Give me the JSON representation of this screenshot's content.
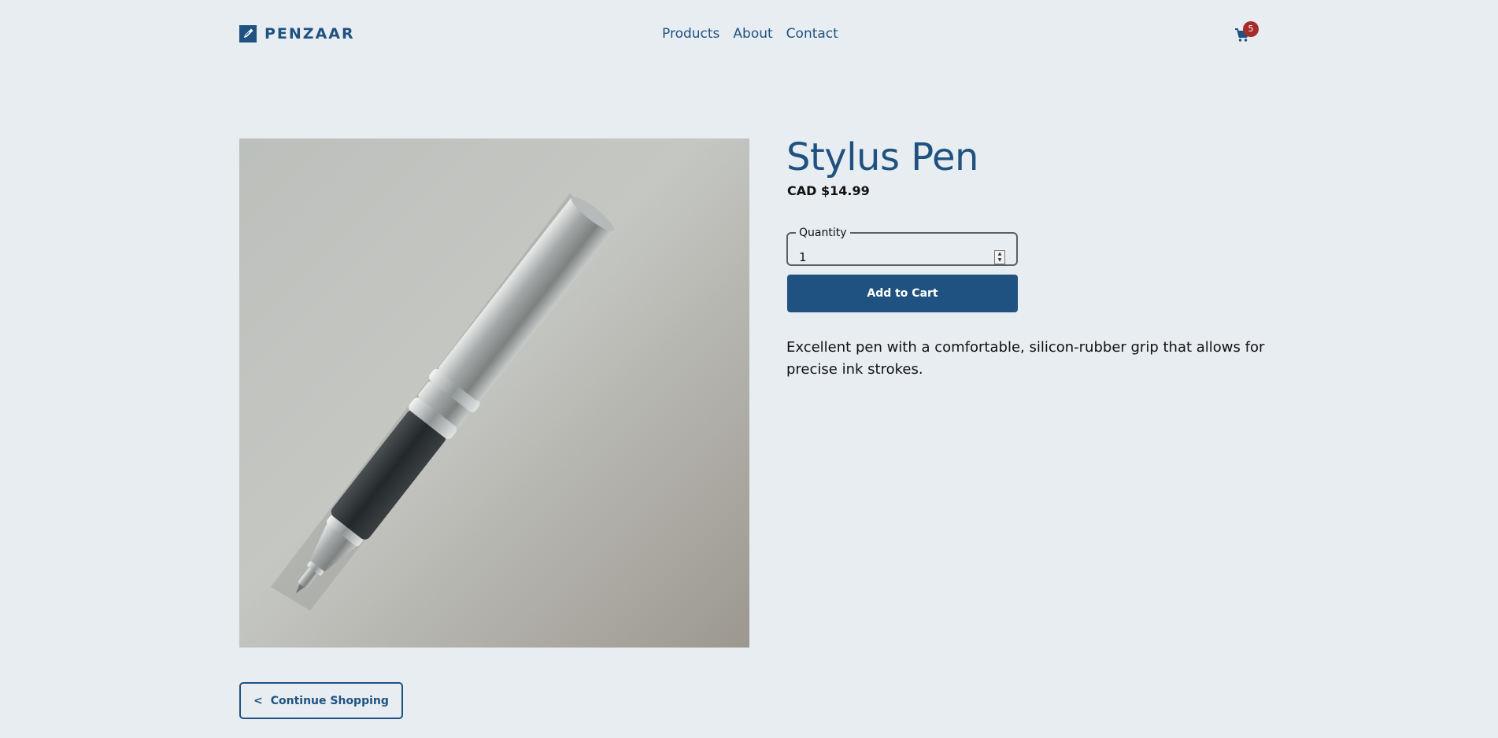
{
  "brand": {
    "name": "PENZAAR",
    "color": "#1f5280"
  },
  "nav": {
    "items": [
      {
        "label": "Products"
      },
      {
        "label": "About"
      },
      {
        "label": "Contact"
      }
    ]
  },
  "cart": {
    "count": "5",
    "icon": "cart-icon",
    "badge_color": "#a62b2b"
  },
  "product": {
    "title": "Stylus Pen",
    "price": "CAD $14.99",
    "quantity_label": "Quantity",
    "quantity_value": "1",
    "add_to_cart_label": "Add to Cart",
    "description": "Excellent pen with a comfortable, silicon-rubber grip that allows for precise ink strokes.",
    "image_subject": "silver pen with black grip"
  },
  "continue_shopping": {
    "chevron": "<",
    "label": "Continue Shopping"
  }
}
